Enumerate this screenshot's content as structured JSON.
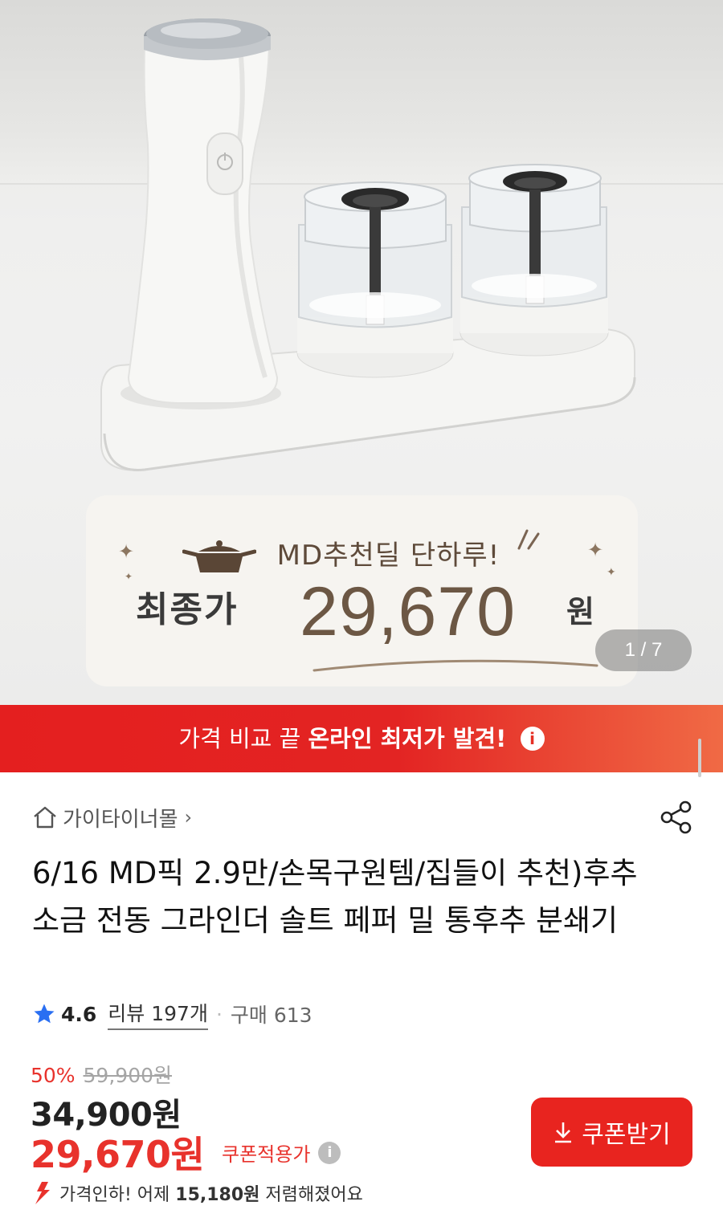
{
  "hero": {
    "promo_headline": "MD추천딜 단하루!",
    "final_label": "최종가",
    "final_price": "29,670",
    "final_unit": "원",
    "image_counter": "1 / 7"
  },
  "banner": {
    "text_prefix": "가격 비교 끝",
    "text_bold": "온라인 최저가 발견!",
    "info_glyph": "i"
  },
  "store": {
    "name": "가이타이너몰",
    "chevron": "›"
  },
  "product": {
    "title": "6/16 MD픽 2.9만/손목구원템/집들이 추천)후추 소금 전동 그라인더 솔트 페퍼 밀 통후추 분쇄기"
  },
  "rating": {
    "score": "4.6",
    "reviews": "리뷰 197개",
    "separator": "·",
    "purchases": "구매 613"
  },
  "price": {
    "discount_pct": "50%",
    "original": "59,900원",
    "sale": "34,900원",
    "final": "29,670원",
    "coupon_applied_label": "쿠폰적용가",
    "info_glyph": "i",
    "drop_prefix": "가격인하! 어제",
    "drop_amount": "15,180원",
    "drop_suffix": "저렴해졌어요"
  },
  "coupon_button": {
    "label": "쿠폰받기"
  },
  "colors": {
    "accent_red": "#e8322c",
    "banner_start": "#e41f1f",
    "banner_end": "#f06a45",
    "promo_brown": "#6c5744",
    "star_blue": "#2a6ff2"
  },
  "icons": {
    "home": "home-icon",
    "share": "share-icon",
    "star": "star-icon",
    "download": "download-icon",
    "price_drop": "arrow-down-icon",
    "pan": "pan-icon"
  }
}
